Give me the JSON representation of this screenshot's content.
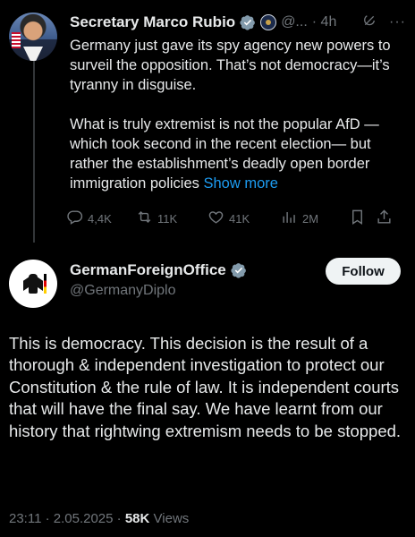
{
  "tweet1": {
    "name": "Secretary Marco Rubio",
    "handle": "@...",
    "time": "· 4h",
    "text_p1": "Germany just gave its spy agency new powers to surveil the opposition.  That’s not democracy—it’s tyranny in disguise.",
    "text_p2": "What is truly extremist is not the popular AfD —which took second in the recent election— but rather the establishment’s deadly open border immigration policies",
    "show_more": "Show more",
    "replies": "4,4K",
    "reposts": "11K",
    "likes": "41K",
    "views": "2M"
  },
  "tweet2": {
    "name": "GermanForeignOffice",
    "handle": "@GermanyDiplo",
    "follow_label": "Follow",
    "text": "This is democracy. This decision is the result of a thorough & independent investigation to protect our Constitution & the rule of law. It is independent courts that will have the final say. We have learnt from our history that rightwing extremism needs to be stopped.",
    "timestamp": "23:11 · 2.05.2025 · ",
    "views_count": "58K",
    "views_label": "Views"
  },
  "colors": {
    "background": "#000000",
    "text": "#e7e9ea",
    "muted": "#71767b",
    "link": "#1d9bf0",
    "verified_blue": "#1d9bf0",
    "verified_gray": "#829aab"
  },
  "icons": [
    "verified-badge-icon",
    "government-seal-icon",
    "grok-icon",
    "more-icon",
    "reply-icon",
    "repost-icon",
    "like-icon",
    "views-icon",
    "bookmark-icon",
    "share-icon"
  ]
}
